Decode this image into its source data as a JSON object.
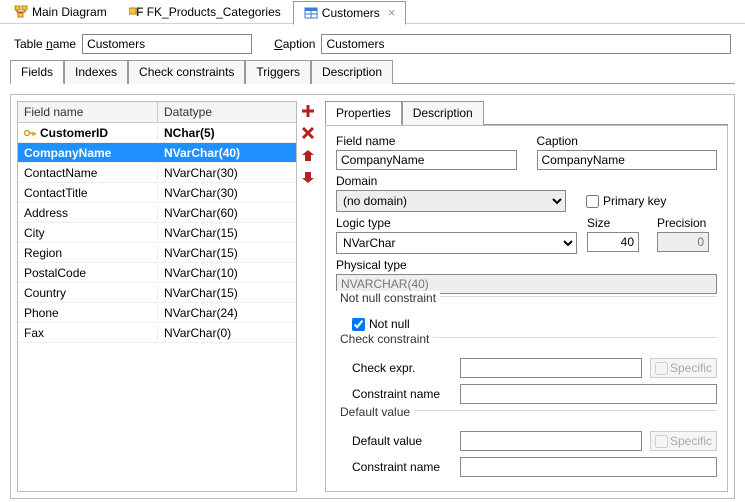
{
  "toptabs": [
    {
      "label": "Main Diagram",
      "icon": "diagram-icon"
    },
    {
      "label": "FK_Products_Categories",
      "icon": "fk-icon"
    },
    {
      "label": "Customers",
      "icon": "table-icon",
      "active": true,
      "closable": true
    }
  ],
  "header": {
    "name_label_pre": "Table ",
    "name_label_u": "n",
    "name_label_post": "ame",
    "name_value": "Customers",
    "caption_label_u": "C",
    "caption_label_post": "aption",
    "caption_value": "Customers"
  },
  "tabs": [
    "Fields",
    "Indexes",
    "Check constraints",
    "Triggers",
    "Description"
  ],
  "tabs_active": 0,
  "fieldtable": {
    "headers": [
      "Field name",
      "Datatype"
    ],
    "rows": [
      {
        "name": "CustomerID",
        "type": "NChar(5)",
        "pk": true
      },
      {
        "name": "CompanyName",
        "type": "NVarChar(40)",
        "selected": true
      },
      {
        "name": "ContactName",
        "type": "NVarChar(30)"
      },
      {
        "name": "ContactTitle",
        "type": "NVarChar(30)"
      },
      {
        "name": "Address",
        "type": "NVarChar(60)"
      },
      {
        "name": "City",
        "type": "NVarChar(15)"
      },
      {
        "name": "Region",
        "type": "NVarChar(15)"
      },
      {
        "name": "PostalCode",
        "type": "NVarChar(10)"
      },
      {
        "name": "Country",
        "type": "NVarChar(15)"
      },
      {
        "name": "Phone",
        "type": "NVarChar(24)"
      },
      {
        "name": "Fax",
        "type": "NVarChar(0)"
      }
    ]
  },
  "toolbuttons": [
    "add-icon",
    "delete-icon",
    "move-up-icon",
    "move-down-icon"
  ],
  "proptabs": [
    "Properties",
    "Description"
  ],
  "proptabs_active": 0,
  "props": {
    "field_name_label": "Field name",
    "field_name_value": "CompanyName",
    "caption_label": "Caption",
    "caption_value": "CompanyName",
    "domain_label": "Domain",
    "domain_value": "(no domain)",
    "primary_key_label": "Primary key",
    "primary_key_checked": false,
    "logic_type_label": "Logic type",
    "logic_type_value": "NVarChar",
    "size_label": "Size",
    "size_value": "40",
    "precision_label": "Precision",
    "precision_value": "0",
    "physical_type_label": "Physical type",
    "physical_type_value": "NVARCHAR(40)",
    "notnull_group": "Not null constraint",
    "notnull_label": "Not null",
    "notnull_checked": true,
    "check_group": "Check constraint",
    "check_expr_label": "Check expr.",
    "check_expr_value": "",
    "check_name_label": "Constraint name",
    "check_name_value": "",
    "default_group": "Default value",
    "default_value_label": "Default value",
    "default_value_value": "",
    "default_name_label": "Constraint name",
    "default_name_value": "",
    "specific_label": "Specific"
  }
}
